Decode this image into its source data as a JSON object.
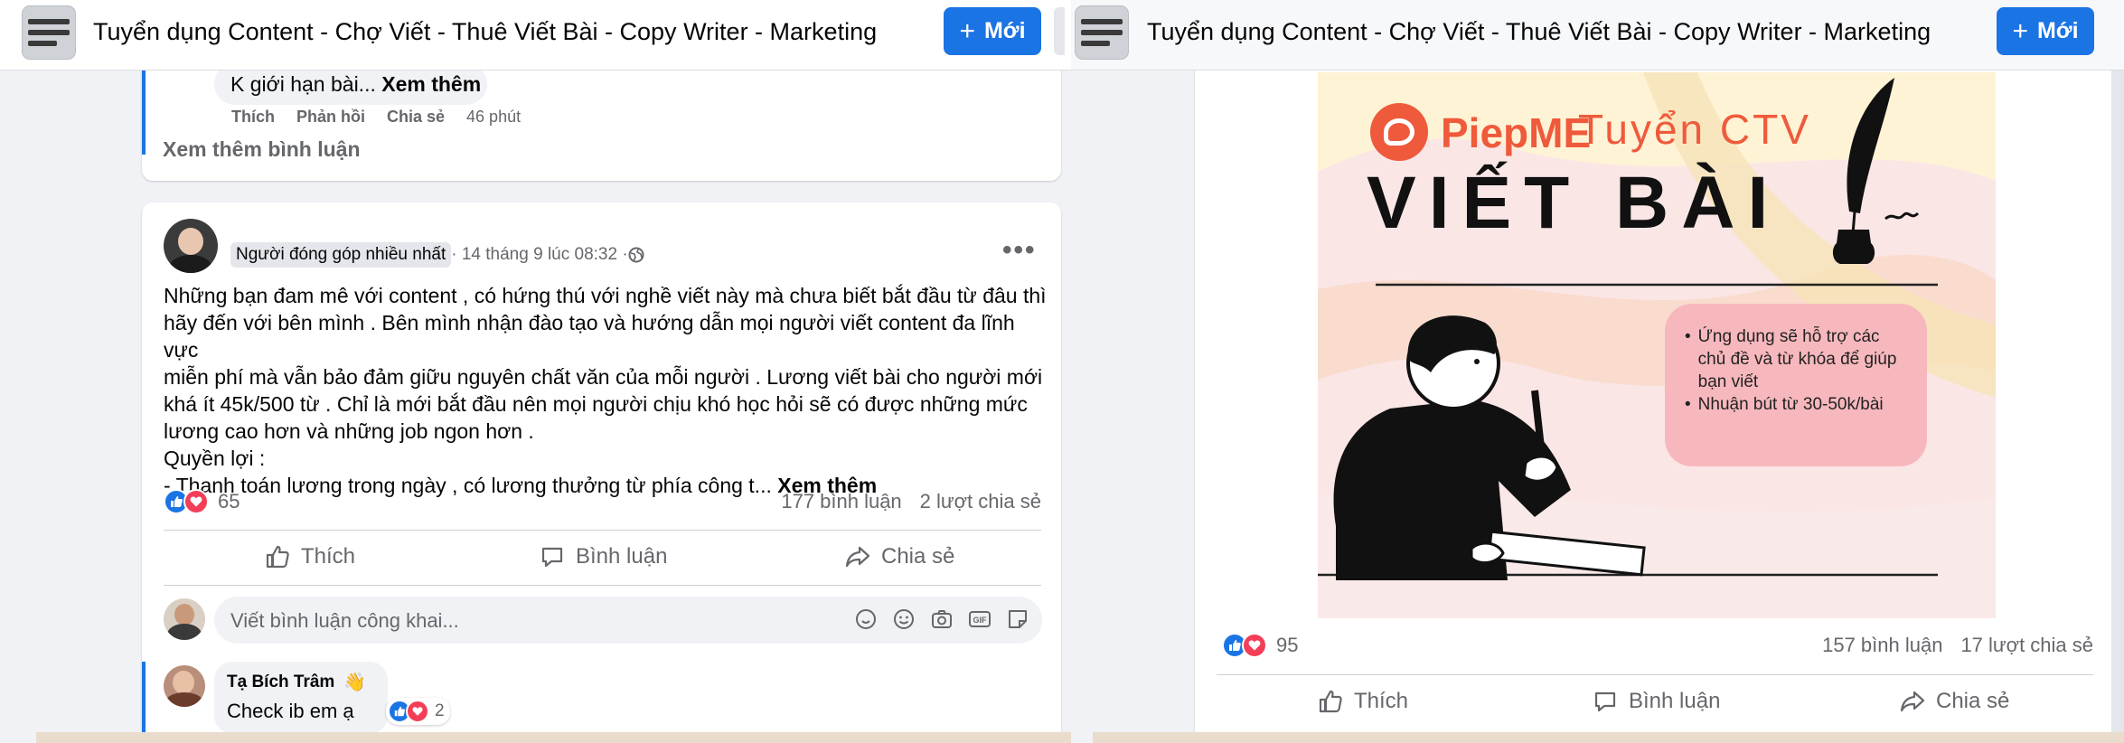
{
  "left": {
    "group_title": "Tuyển dụng Content - Chợ Viết - Thuê Viết Bài - Copy Writer - Marketing",
    "new_button": "Mới",
    "prev_comment": {
      "text": "K giới hạn bài...",
      "see_more": "Xem thêm",
      "like": "Thích",
      "reply": "Phản hồi",
      "share": "Chia sẻ",
      "time": "46 phút"
    },
    "more_comments": "Xem thêm bình luận",
    "post": {
      "badge": "Người đóng góp nhiều nhất",
      "meta": " · 14 tháng 9 lúc 08:32 · ",
      "body_lines": [
        "Những bạn đam mê với content , có hứng thú với nghề viết này mà chưa biết bắt đầu từ đâu thì",
        "hãy đến với bên mình . Bên mình nhận đào tạo và hướng dẫn mọi người viết content đa lĩnh vực",
        "miễn phí mà vẫn bảo đảm giữu nguyên chất văn của mỗi người . Lương viết bài cho người mới",
        "khá ít 45k/500 từ . Chỉ là mới bắt đầu nên mọi người chịu khó học hỏi sẽ có được những mức",
        "lương cao hơn và những job ngon hơn .",
        "Quyền lợi :",
        "- Thanh toán lương trong ngày , có lương thưởng từ phía công t..."
      ],
      "see_more": "Xem thêm",
      "reaction_count": "65",
      "comments": "177 bình luận",
      "shares": "2 lượt chia sẻ",
      "like": "Thích",
      "comment": "Bình luận",
      "share": "Chia sẻ",
      "comment_placeholder": "Viết bình luận công khai...",
      "reply": {
        "name": "Tạ Bích Trâm",
        "text": "Check ib em ạ",
        "reactions": "2"
      }
    }
  },
  "right": {
    "group_title": "Tuyển dụng Content - Chợ Viết - Thuê Viết Bài - Copy Writer - Marketing",
    "new_button": "Mới",
    "poster": {
      "brand": "PiepME",
      "headline1": "Tuyển CTV",
      "headline2": "VIẾT BÀI",
      "bullets": [
        "Ứng dụng sẽ hỗ trợ các chủ đề và từ khóa để giúp bạn viết",
        "Nhuận bút từ 30-50k/bài"
      ]
    },
    "reaction_count": "95",
    "comments": "157 bình luận",
    "shares": "17 lượt chia sẻ",
    "like": "Thích",
    "comment": "Bình luận",
    "share": "Chia sẻ"
  },
  "colors": {
    "accent": "#1b74e4",
    "love": "#f33e58",
    "poster_bg": "#fbe6e6",
    "poster_orange": "#ef5a3c"
  }
}
